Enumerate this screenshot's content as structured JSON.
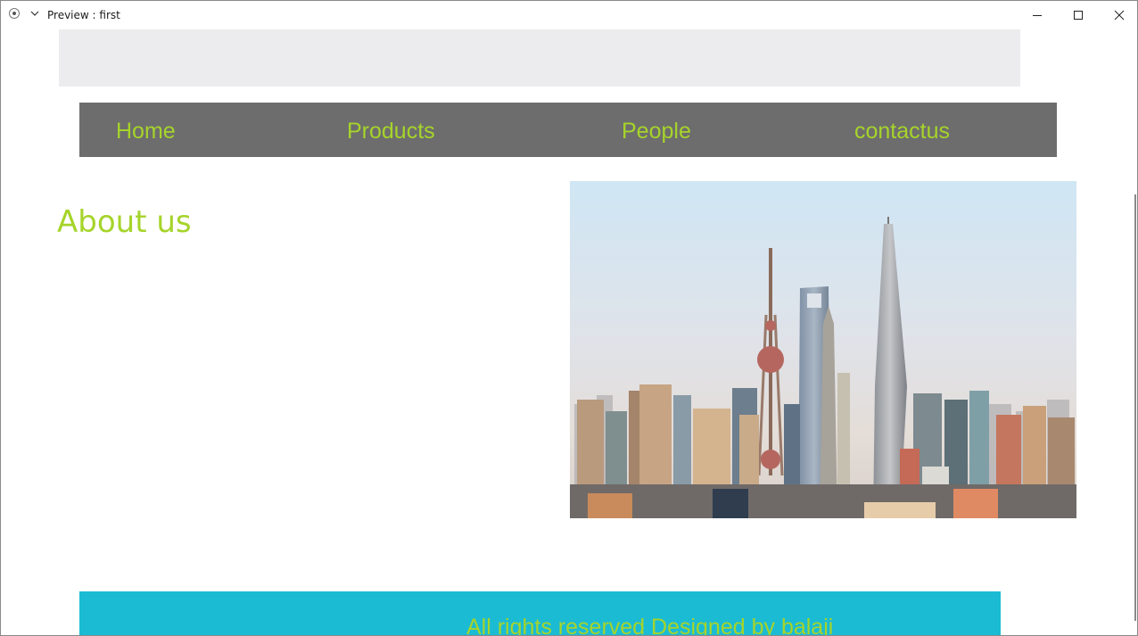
{
  "window": {
    "title": "Preview : first",
    "controls": {
      "minimize": "minimize-icon",
      "maximize": "maximize-icon",
      "close": "close-icon"
    }
  },
  "nav": {
    "items": [
      {
        "label": "Home"
      },
      {
        "label": "Products"
      },
      {
        "label": "People"
      },
      {
        "label": "contactus"
      }
    ]
  },
  "main": {
    "heading": "About us",
    "image": {
      "subject": "city-skyline"
    }
  },
  "footer": {
    "text": "All rights reserved Designed by balaji"
  },
  "colors": {
    "accent_text": "#a6d42a",
    "nav_background": "#6d6d6d",
    "header_band": "#ececee",
    "footer_background": "#1bbbd3"
  }
}
